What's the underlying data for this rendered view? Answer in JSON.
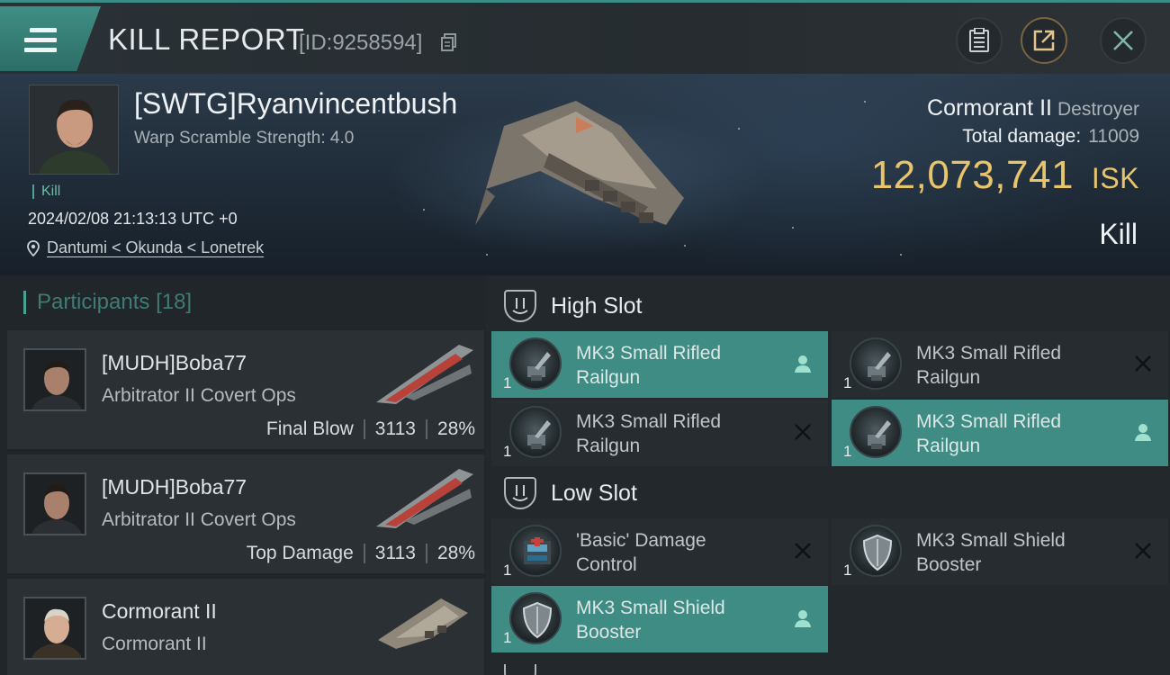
{
  "header": {
    "title": "KILL REPORT",
    "report_id": "[ID:9258594]"
  },
  "victim": {
    "name": "[SWTG]Ryanvincentbush",
    "subtitle": "Warp Scramble Strength: 4.0",
    "tag": "Kill",
    "time": "2024/02/08 21:13:13 UTC +0",
    "location": "Dantumi < Okunda < Lonetrek",
    "ship_name": "Cormorant II",
    "ship_class": "Destroyer",
    "total_damage_label": "Total damage:",
    "total_damage": "11009",
    "isk_value": "12,073,741",
    "isk_unit": "ISK",
    "result": "Kill"
  },
  "participants": {
    "label": "Participants",
    "count": "[18]",
    "items": [
      {
        "name": "[MUDH]Boba77",
        "ship": "Arbitrator II Covert Ops",
        "role": "Final Blow",
        "damage": "3113",
        "percent": "28%"
      },
      {
        "name": "[MUDH]Boba77",
        "ship": "Arbitrator II Covert Ops",
        "role": "Top Damage",
        "damage": "3113",
        "percent": "28%"
      },
      {
        "name": "Cormorant II",
        "ship": "Cormorant II",
        "role": "",
        "damage": "",
        "percent": ""
      }
    ]
  },
  "slots": {
    "high": {
      "label": "High Slot",
      "modules": [
        {
          "line1": "MK3 Small Rifled",
          "line2": "Railgun",
          "qty": "1",
          "status": "pilot-icon",
          "fitted": true
        },
        {
          "line1": "MK3 Small Rifled",
          "line2": "Railgun",
          "qty": "1",
          "status": "destroyed-x-icon",
          "fitted": false
        },
        {
          "line1": "MK3 Small Rifled",
          "line2": "Railgun",
          "qty": "1",
          "status": "destroyed-x-icon",
          "fitted": false
        },
        {
          "line1": "MK3 Small Rifled",
          "line2": "Railgun",
          "qty": "1",
          "status": "pilot-icon",
          "fitted": true
        }
      ]
    },
    "low": {
      "label": "Low Slot",
      "modules": [
        {
          "line1": "'Basic' Damage",
          "line2": "Control",
          "qty": "1",
          "status": "destroyed-x-icon",
          "fitted": false
        },
        {
          "line1": "MK3 Small Shield",
          "line2": "Booster",
          "qty": "1",
          "status": "destroyed-x-icon",
          "fitted": false
        },
        {
          "line1": "MK3 Small Shield",
          "line2": "Booster",
          "qty": "1",
          "status": "pilot-icon",
          "fitted": true
        }
      ]
    }
  },
  "colors": {
    "accent": "#3f8c84",
    "isk": "#e8c56c",
    "panel": "#2a3034"
  }
}
